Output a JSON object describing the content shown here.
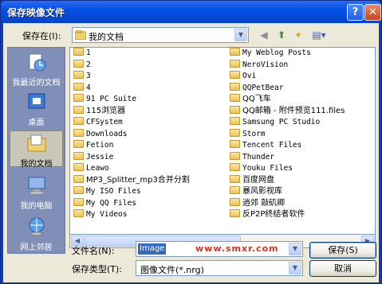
{
  "window": {
    "title": "保存映像文件",
    "help_label": "?",
    "close_label": "✕"
  },
  "lookin": {
    "label": "保存在(I):",
    "value": "我的文档"
  },
  "places": [
    {
      "label": "我最近的文档",
      "icon": "recent-documents-icon"
    },
    {
      "label": "桌面",
      "icon": "desktop-icon"
    },
    {
      "label": "我的文档",
      "icon": "my-documents-icon",
      "selected": true
    },
    {
      "label": "我的电脑",
      "icon": "my-computer-icon"
    },
    {
      "label": "网上邻居",
      "icon": "network-places-icon"
    }
  ],
  "files": {
    "col1": [
      "1",
      "2",
      "3",
      "4",
      "91 PC Suite",
      "115浏览器",
      "CFSystem",
      "Downloads",
      "Fetion",
      "Jessie",
      "Leawo",
      "MP3_Splitter_mp3合并分割",
      "My ISO Files",
      "My QQ Files",
      "My Videos"
    ],
    "col2": [
      "My Weblog Posts",
      "NeroVision",
      "Ovi",
      "QQPetBear",
      "QQ飞车",
      "QQ邮箱 - 附件预览111.files",
      "Samsung PC Studio",
      "Storm",
      "Tencent Files",
      "Thunder",
      "Youku Files",
      "百度网盘",
      "暴风影视库",
      "逍郊 敲矶卿",
      "反P2P终结者软件"
    ]
  },
  "filename": {
    "label": "文件名(N):",
    "value": "Image",
    "watermark": "www.smxr.com"
  },
  "filetype": {
    "label": "保存类型(T):",
    "value": "图像文件(*.nrg)"
  },
  "buttons": {
    "save": "保存(S)",
    "cancel": "取消"
  }
}
